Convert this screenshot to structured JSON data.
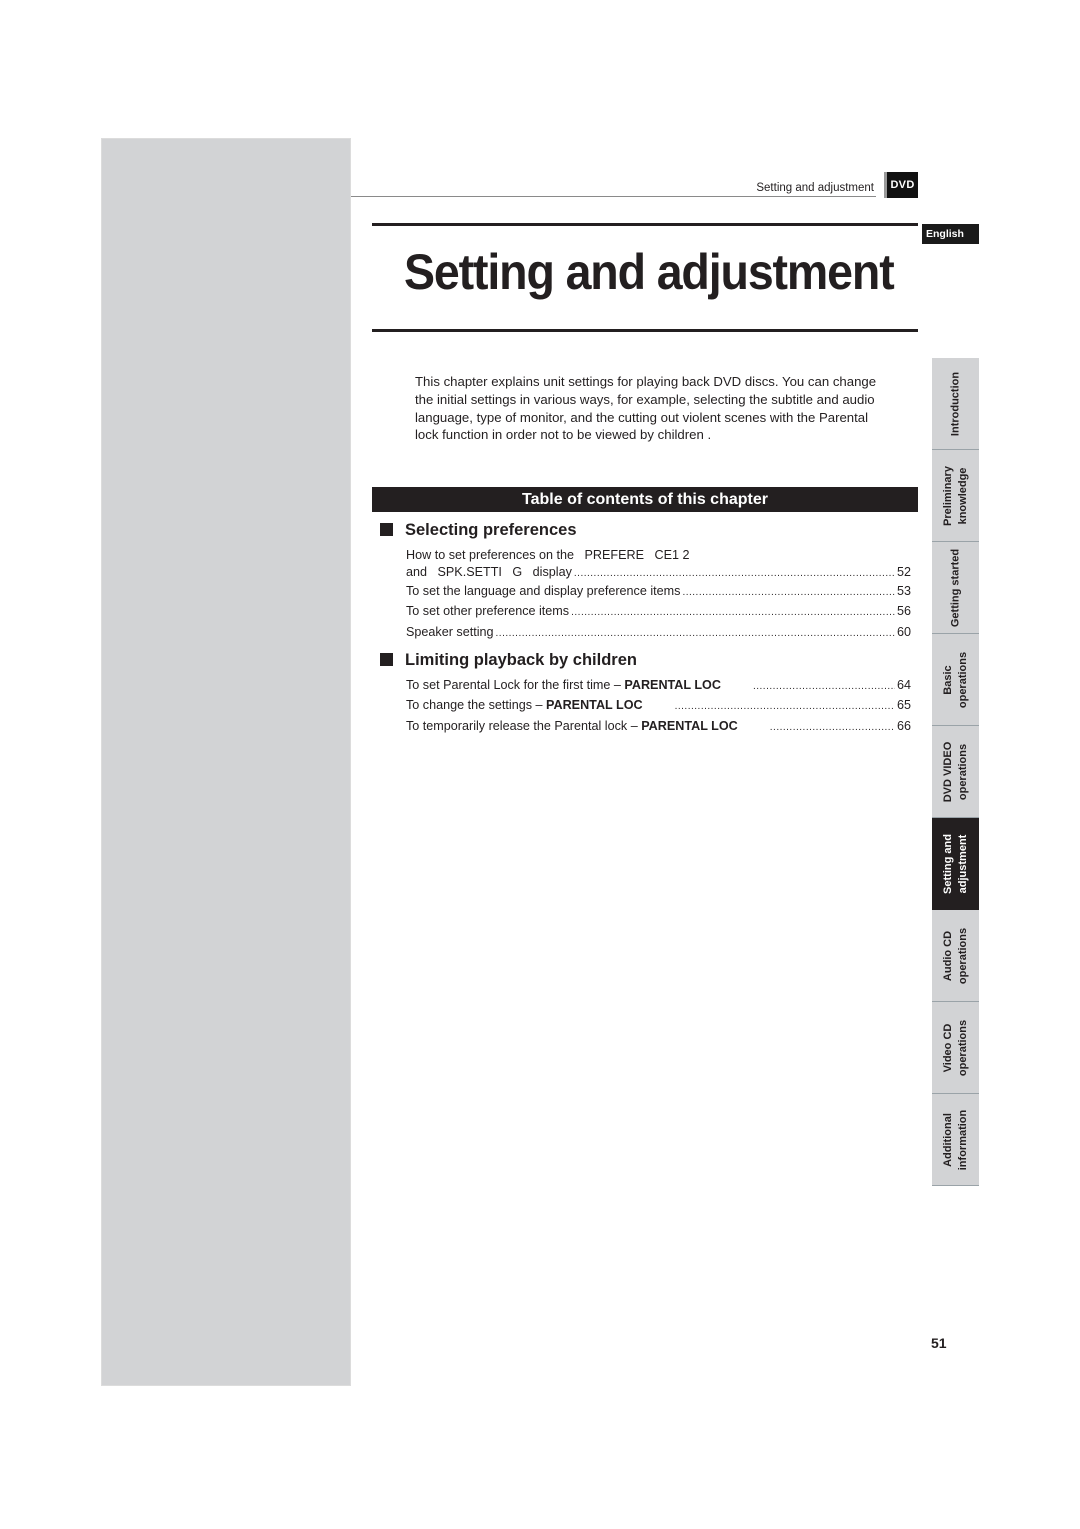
{
  "header": {
    "running_title": "Setting and adjustment",
    "format_badge": "DVD",
    "language_badge": "English"
  },
  "page_title": "Setting and adjustment",
  "intro_text": "This chapter explains unit settings for playing back DVD discs. You can change the initial settings in various ways, for example, selecting the subtitle and audio language, type of monitor, and the cutting out violent scenes with the Parental lock function in order not to be viewed by children .",
  "toc": {
    "heading": "Table of contents of this chapter",
    "sections": [
      {
        "title": "Selecting preferences",
        "entries": [
          {
            "label": "How to set preferences on the   PREFERE   CE1 2",
            "continuation": "and   SPK.SETTI   G   display",
            "bold": "",
            "page": "52"
          },
          {
            "label": "To set the language and display preference items",
            "bold": "",
            "page": "53"
          },
          {
            "label": "To set other preference items",
            "bold": "",
            "page": "56"
          },
          {
            "label": "Speaker setting",
            "bold": "",
            "page": "60"
          }
        ]
      },
      {
        "title": "Limiting playback by children",
        "entries": [
          {
            "label": "To set Parental Lock for the first time – ",
            "bold": "PARENTAL LOC",
            "page": "64"
          },
          {
            "label": "To change the settings – ",
            "bold": "PARENTAL LOC",
            "page": "65"
          },
          {
            "label": "To temporarily release the Parental lock – ",
            "bold": "PARENTAL LOC",
            "page": "66"
          }
        ]
      }
    ]
  },
  "side_tabs": [
    {
      "lines": [
        "Introduction"
      ],
      "active": false
    },
    {
      "lines": [
        "Preliminary",
        "knowledge"
      ],
      "active": false
    },
    {
      "lines": [
        "Getting started"
      ],
      "active": false
    },
    {
      "lines": [
        "Basic",
        "operations"
      ],
      "active": false
    },
    {
      "lines": [
        "DVD VIDEO",
        "operations"
      ],
      "active": false
    },
    {
      "lines": [
        "Setting and",
        "adjustment"
      ],
      "active": true
    },
    {
      "lines": [
        "Audio CD",
        "operations"
      ],
      "active": false
    },
    {
      "lines": [
        "Video CD",
        "operations"
      ],
      "active": false
    },
    {
      "lines": [
        "Additional",
        "information"
      ],
      "active": false
    }
  ],
  "page_number": "51"
}
